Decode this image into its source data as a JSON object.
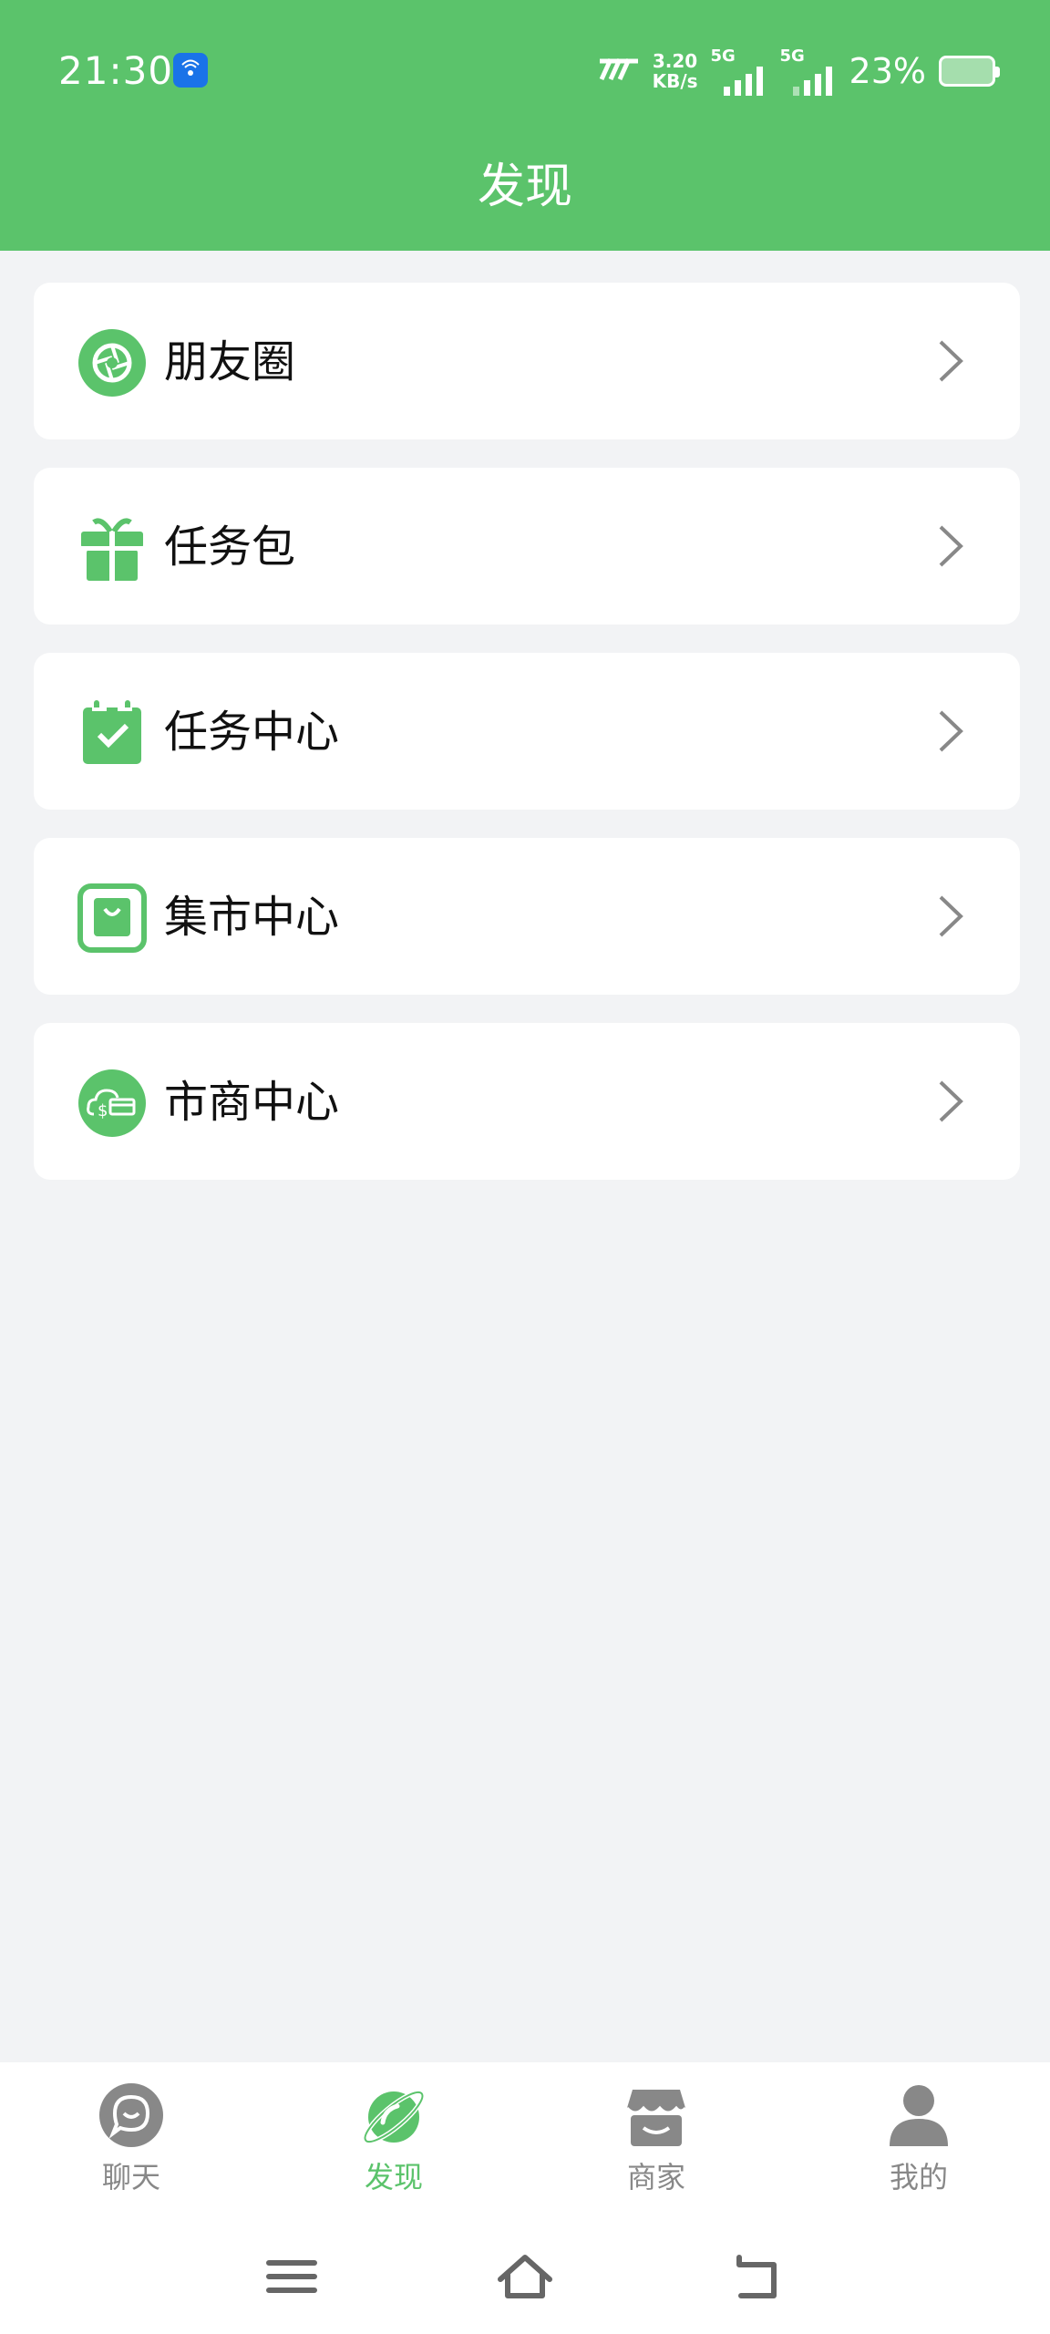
{
  "status_bar": {
    "time": "21:30",
    "speed_value": "3.20",
    "speed_unit": "KB/s",
    "signal1_label": "5G",
    "signal2_label": "5G",
    "battery_percent": "23%",
    "battery_level": 0.23
  },
  "header": {
    "title": "发现"
  },
  "menu": {
    "items": [
      {
        "label": "朋友圈",
        "icon": "moments-aperture-icon"
      },
      {
        "label": "任务包",
        "icon": "gift-icon"
      },
      {
        "label": "任务中心",
        "icon": "calendar-check-icon"
      },
      {
        "label": "集市中心",
        "icon": "shopping-bag-icon"
      },
      {
        "label": "市商中心",
        "icon": "cloud-money-icon"
      }
    ]
  },
  "tabs": {
    "items": [
      {
        "label": "聊天",
        "icon": "chat-bubble-icon",
        "active": false
      },
      {
        "label": "发现",
        "icon": "planet-icon",
        "active": true
      },
      {
        "label": "商家",
        "icon": "store-icon",
        "active": false
      },
      {
        "label": "我的",
        "icon": "person-icon",
        "active": false
      }
    ]
  },
  "system_nav": {
    "buttons": [
      "menu-icon",
      "home-icon",
      "back-icon"
    ]
  },
  "colors": {
    "brand_green": "#5bc36b",
    "background": "#f2f3f5",
    "inactive_gray": "#888888"
  }
}
